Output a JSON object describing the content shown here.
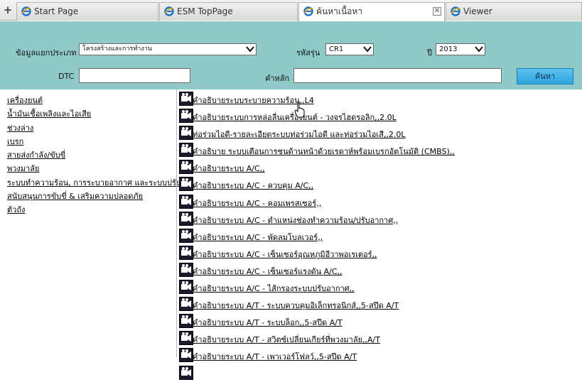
{
  "tabs": [
    {
      "label": "Start Page"
    },
    {
      "label": "ESM TopPage"
    },
    {
      "label": "ค้นหาเนื้อหา"
    },
    {
      "label": "Viewer"
    }
  ],
  "new_tab_icon": "plus-icon",
  "search": {
    "category_label": "ข้อมูลแยกประเภท",
    "category_value": "โครงสร้างและการทำงาน",
    "model_label": "รหัสรุ่น",
    "model_value": "CR1",
    "year_label": "ปี",
    "year_value": "2013",
    "dtc_label": "DTC",
    "dtc_value": "",
    "keyword_label": "คำหลัก",
    "keyword_value": "",
    "search_button": "ค้นหา"
  },
  "categories": [
    "เครื่องยนต์",
    "น้ำมันเชื้อเพลิงและไอเสีย",
    "ช่วงล่าง",
    "เบรก",
    "สายส่งกำลัง/ขับขี่",
    "พวงมาลัย",
    "ระบบทำความร้อน, การระบายอากาศ และระบบปรับ",
    "สนับสนุนการขับขี่ & เสริมความปลอดภัย",
    "ตัวถัง"
  ],
  "results": [
    "คำอธิบายระบบระบายความร้อน,,L4",
    "คำอธิบายระบบการหล่อลื่นเครื่องยนต์ - วงจรไฮดรอลิก,,2.0L",
    "ท่อร่วมไอดี-รายละเอียดระบบท่อร่วมไอดี และท่อร่วมไอเสี,,2.0L",
    "คำอธิบาย ระบบเตือนการชนด้านหน้าด้วยเรดาห์พร้อมเบรกอัตโนมัติ (CMBS),,",
    "คำอธิบายระบบ A/C,,",
    "คำอธิบายระบบ A/C - ควบคุม A/C,,",
    "คำอธิบายระบบ A/C - คอมเพรสเซอร์,,",
    "คำอธิบายระบบ A/C - ตำแหน่งช่องทำความร้อน/ปรับอากาศ,,",
    "คำอธิบายระบบ A/C - พัดลมโบลเวอร์,,",
    "คำอธิบายระบบ A/C - เซ็นเซอร์อุณหภูมิอีวาพอเรเตอร์,,",
    "คำอธิบายระบบ A/C - เซ็นเซอร์แรงดัน A/C,,",
    "คำอธิบายระบบ A/C - ไส้กรองระบบปรับอากาศ,,",
    "คำอธิบายระบบ A/T - ระบบควบคุมอิเล็กทรอนิกส์,,5-สปีด A/T",
    "คำอธิบายระบบ A/T - ระบบล็อก,,5-สปีด A/T",
    "คำอธิบายระบบ A/T - สวิตซ์เปลี่ยนเกียร์ที่พวงมาลัย,,A/T",
    "คำอธิบายระบบ A/T - เพาเวอร์โฟลว์,,5-สปีด A/T",
    ""
  ],
  "colors": {
    "panel_bg": "#8fcac8",
    "button_bg": "#2aa5de"
  }
}
